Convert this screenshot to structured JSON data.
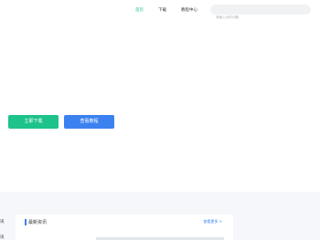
{
  "nav": {
    "items": [
      {
        "label": "首页",
        "active": true
      },
      {
        "label": "下载",
        "active": false
      },
      {
        "label": "教程中心",
        "active": false
      }
    ],
    "search_placeholder": "请输入你的问题"
  },
  "hero": {
    "download_label": "立即下载",
    "tutorial_label": "查看教程"
  },
  "news": {
    "title": "最新资讯",
    "more_label": "查看更多 >",
    "side_labels": [
      "讯",
      "讯"
    ]
  },
  "colors": {
    "accent_green": "#1ec28b",
    "accent_blue": "#3b82f0"
  }
}
